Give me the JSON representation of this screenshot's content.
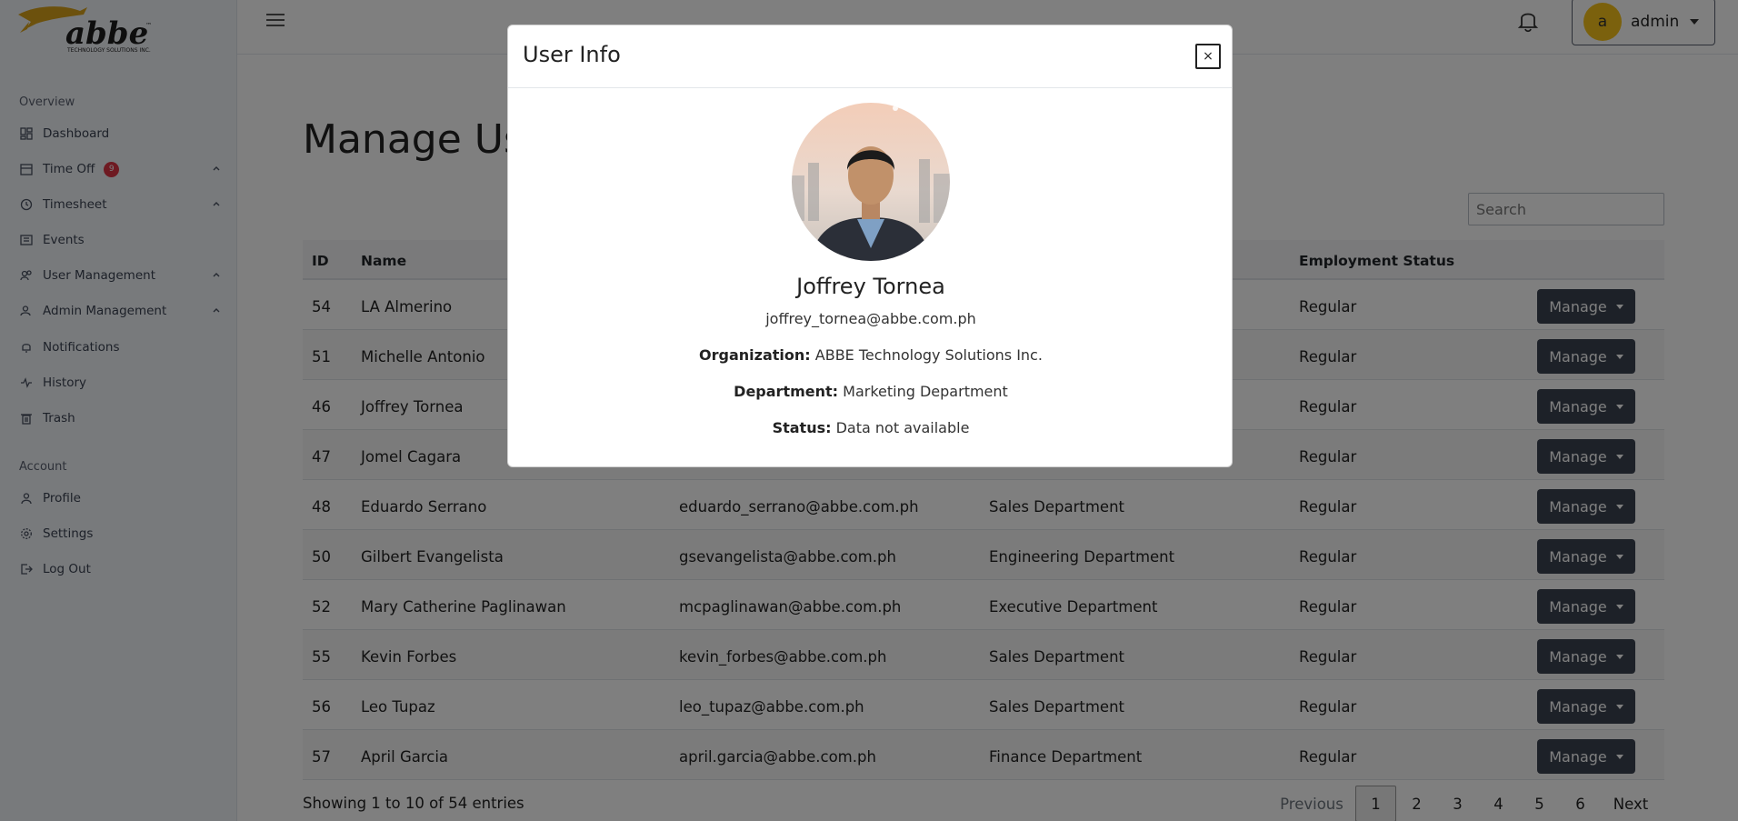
{
  "sidebar": {
    "sections": {
      "overview": "Overview",
      "account": "Account"
    },
    "items": [
      {
        "label": "Dashboard",
        "icon": "dashboard-icon"
      },
      {
        "label": "Time Off",
        "icon": "calendar-icon",
        "badge": "9"
      },
      {
        "label": "Timesheet",
        "icon": "clock-icon"
      },
      {
        "label": "Events",
        "icon": "list-icon"
      },
      {
        "label": "User Management",
        "icon": "users-icon"
      },
      {
        "label": "Admin Management",
        "icon": "admin-icon"
      },
      {
        "label": "Notifications",
        "icon": "bell-icon"
      },
      {
        "label": "History",
        "icon": "activity-icon"
      },
      {
        "label": "Trash",
        "icon": "trash-icon"
      },
      {
        "label": "Profile",
        "icon": "user-icon"
      },
      {
        "label": "Settings",
        "icon": "gear-icon"
      },
      {
        "label": "Log Out",
        "icon": "logout-icon"
      }
    ]
  },
  "topbar": {
    "avatar_letter": "a",
    "user_name": "admin"
  },
  "main": {
    "title": "Manage Us",
    "search_placeholder": "Search",
    "columns": {
      "id": "ID",
      "name": "Name",
      "status": "Employment Status"
    },
    "manage_label": "Manage",
    "rows": [
      {
        "id": "54",
        "name": "LA Almerino",
        "email": "",
        "dept": "",
        "status": "Regular"
      },
      {
        "id": "51",
        "name": "Michelle Antonio",
        "email": "",
        "dept": "",
        "status": "Regular"
      },
      {
        "id": "46",
        "name": "Joffrey Tornea",
        "email": "",
        "dept": "",
        "status": "Regular"
      },
      {
        "id": "47",
        "name": "Jomel Cagara",
        "email": "",
        "dept": "",
        "status": "Regular"
      },
      {
        "id": "48",
        "name": "Eduardo Serrano",
        "email": "eduardo_serrano@abbe.com.ph",
        "dept": "Sales Department",
        "status": "Regular"
      },
      {
        "id": "50",
        "name": "Gilbert Evangelista",
        "email": "gsevangelista@abbe.com.ph",
        "dept": "Engineering Department",
        "status": "Regular"
      },
      {
        "id": "52",
        "name": "Mary Catherine Paglinawan",
        "email": "mcpaglinawan@abbe.com.ph",
        "dept": "Executive Department",
        "status": "Regular"
      },
      {
        "id": "55",
        "name": "Kevin Forbes",
        "email": "kevin_forbes@abbe.com.ph",
        "dept": "Sales Department",
        "status": "Regular"
      },
      {
        "id": "56",
        "name": "Leo Tupaz",
        "email": "leo_tupaz@abbe.com.ph",
        "dept": "Sales Department",
        "status": "Regular"
      },
      {
        "id": "57",
        "name": "April Garcia",
        "email": "april.garcia@abbe.com.ph",
        "dept": "Finance Department",
        "status": "Regular"
      }
    ],
    "entries_text": "Showing 1 to 10 of 54 entries",
    "pagination": {
      "previous": "Previous",
      "pages": [
        "1",
        "2",
        "3",
        "4",
        "5",
        "6"
      ],
      "next": "Next"
    }
  },
  "modal": {
    "title": "User Info",
    "close_label": "×",
    "name": "Joffrey Tornea",
    "email": "joffrey_tornea@abbe.com.ph",
    "organization_label": "Organization:",
    "organization": "ABBE Technology Solutions Inc.",
    "department_label": "Department:",
    "department": "Marketing Department",
    "status_label": "Status:",
    "status": "Data not available"
  },
  "colors": {
    "sidebar_bg": "#f1f4f8",
    "manage_button": "#3b4351",
    "badge": "#dc3545",
    "avatar": "#f7c21a"
  }
}
